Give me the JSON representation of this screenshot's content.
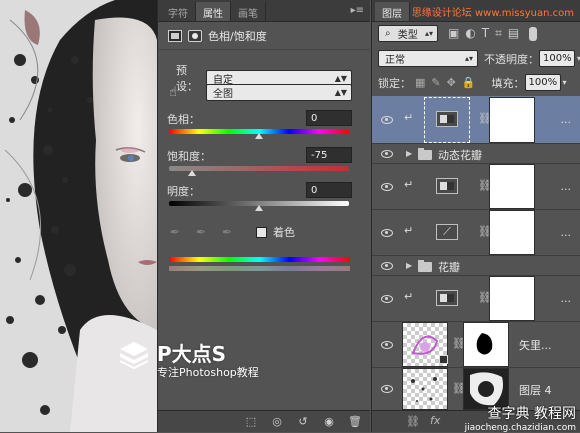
{
  "watermark": {
    "top_right": "思缘设计论坛 www.missyuan.com",
    "logo_title": "P大点S",
    "logo_subtitle": "专注Photoshop教程",
    "bottom_right": "查字典 教程网",
    "bottom_right_url": "jiaocheng.chazidian.com"
  },
  "properties_panel": {
    "tabs": [
      "字符",
      "属性",
      "画笔"
    ],
    "active_tab": "属性",
    "title": "色相/饱和度",
    "preset_label": "预设：",
    "preset_value": "自定",
    "channel_value": "全图",
    "hue_label": "色相：",
    "hue_value": "0",
    "saturation_label": "饱和度：",
    "saturation_value": "-75",
    "lightness_label": "明度：",
    "lightness_value": "0",
    "colorize_label": "着色",
    "hue_level": 0.5,
    "saturation_level": 0.125,
    "lightness_level": 0.5
  },
  "layers_panel": {
    "tabs": [
      "图层"
    ],
    "filter_value": "类型",
    "blend_mode": "正常",
    "opacity_label": "不透明度：",
    "opacity_value": "100%",
    "lock_label": "锁定：",
    "fill_label": "填充：",
    "fill_value": "100%",
    "layers": [
      {
        "kind": "adjustment",
        "name": "...",
        "selected": true
      },
      {
        "kind": "group",
        "name": "动态花瓣"
      },
      {
        "kind": "adjustment",
        "name": "..."
      },
      {
        "kind": "curves",
        "name": "..."
      },
      {
        "kind": "group",
        "name": "花瓣"
      },
      {
        "kind": "adjustment",
        "name": "..."
      },
      {
        "kind": "smart",
        "name": "矢里..."
      },
      {
        "kind": "pixel",
        "name": "图层 4"
      }
    ]
  },
  "colors": {
    "panel_bg": "#535353",
    "tab_bar": "#3c3c3c",
    "selected_layer": "#6c7ea1"
  }
}
